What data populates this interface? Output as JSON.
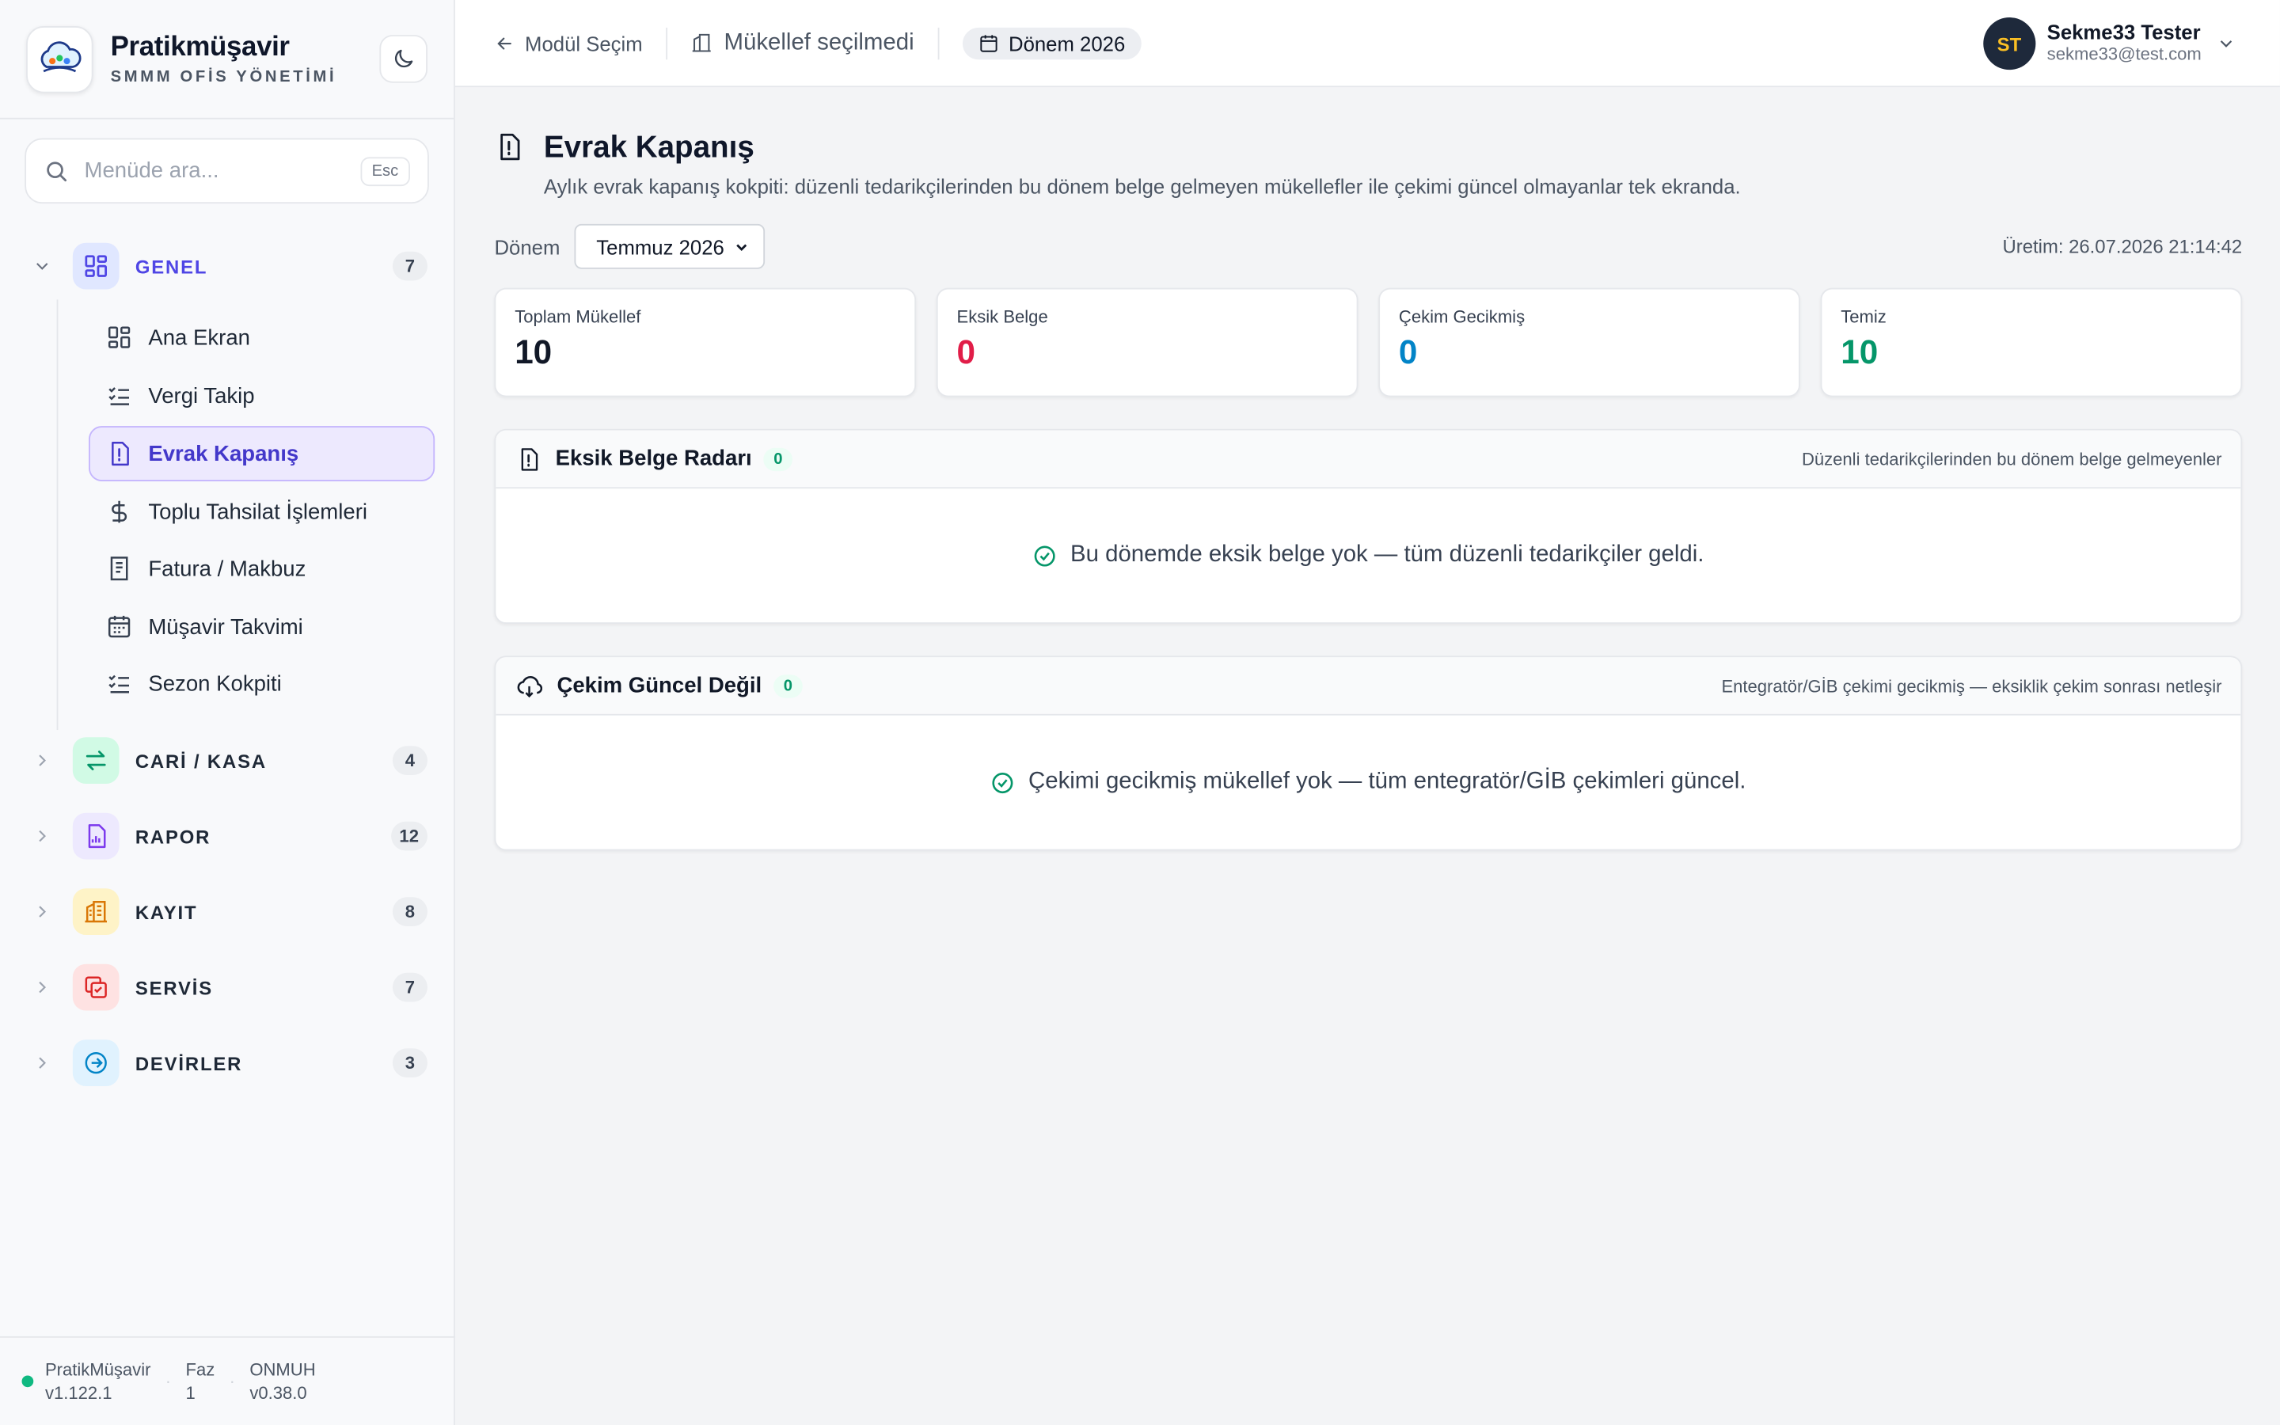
{
  "brand": {
    "title": "Pratikmüşavir",
    "subtitle": "SMMM OFİS YÖNETİMİ"
  },
  "search": {
    "placeholder": "Menüde ara...",
    "shortcut": "Esc"
  },
  "sidebar": {
    "groups": [
      {
        "label": "GENEL",
        "count": "7",
        "icon": "grid-icon",
        "color": "#4f46e5",
        "expanded": true
      },
      {
        "label": "CARİ / KASA",
        "count": "4",
        "icon": "arrows-swap-icon",
        "color": "#059669",
        "expanded": false
      },
      {
        "label": "RAPOR",
        "count": "12",
        "icon": "report-icon",
        "color": "#7c3aed",
        "expanded": false
      },
      {
        "label": "KAYIT",
        "count": "8",
        "icon": "building-icon",
        "color": "#d97706",
        "expanded": false
      },
      {
        "label": "SERVİS",
        "count": "7",
        "icon": "copy-check-icon",
        "color": "#dc2626",
        "expanded": false
      },
      {
        "label": "DEVİRLER",
        "count": "3",
        "icon": "circle-arrow-icon",
        "color": "#0284c7",
        "expanded": false
      }
    ],
    "items": [
      {
        "label": "Ana Ekran",
        "icon": "grid-icon",
        "active": false
      },
      {
        "label": "Vergi Takip",
        "icon": "checklist-icon",
        "active": false
      },
      {
        "label": "Evrak Kapanış",
        "icon": "file-alert-icon",
        "active": true
      },
      {
        "label": "Toplu Tahsilat İşlemleri",
        "icon": "dollar-icon",
        "active": false
      },
      {
        "label": "Fatura / Makbuz",
        "icon": "receipt-icon",
        "active": false
      },
      {
        "label": "Müşavir Takvimi",
        "icon": "calendar-icon",
        "active": false
      },
      {
        "label": "Sezon Kokpiti",
        "icon": "checklist-icon",
        "active": false
      }
    ]
  },
  "footer": {
    "app_name": "PratikMüşavir",
    "app_version": "v1.122.1",
    "phase_label": "Faz",
    "phase_value": "1",
    "module_name": "ONMUH",
    "module_version": "v0.38.0"
  },
  "topbar": {
    "back_label": "Modül Seçim",
    "taxpayer_label": "Mükellef seçilmedi",
    "period_label": "Dönem 2026"
  },
  "user": {
    "initials": "ST",
    "name": "Sekme33 Tester",
    "email": "sekme33@test.com"
  },
  "page": {
    "title": "Evrak Kapanış",
    "description": "Aylık evrak kapanış kokpiti: düzenli tedarikçilerinden bu dönem belge gelmeyen mükellefler ile çekimi güncel olmayanlar tek ekranda.",
    "period_filter_label": "Dönem",
    "period_value": "Temmuz 2026",
    "generated_at": "Üretim: 26.07.2026 21:14:42"
  },
  "stats": [
    {
      "title": "Toplam Mükellef",
      "value": "10",
      "color": "#111827"
    },
    {
      "title": "Eksik Belge",
      "value": "0",
      "color": "#e11d48"
    },
    {
      "title": "Çekim Gecikmiş",
      "value": "0",
      "color": "#0284c7"
    },
    {
      "title": "Temiz",
      "value": "10",
      "color": "#059669"
    }
  ],
  "panels": [
    {
      "title": "Eksik Belge Radarı",
      "count": "0",
      "note": "Düzenli tedarikçilerinden bu dönem belge gelmeyenler",
      "message": "Bu dönemde eksik belge yok — tüm düzenli tedarikçiler geldi."
    },
    {
      "title": "Çekim Güncel Değil",
      "count": "0",
      "note": "Entegratör/GİB çekimi gecikmiş — eksiklik çekim sonrası netleşir",
      "message": "Çekimi gecikmiş mükellef yok — tüm entegratör/GİB çekimleri güncel."
    }
  ]
}
